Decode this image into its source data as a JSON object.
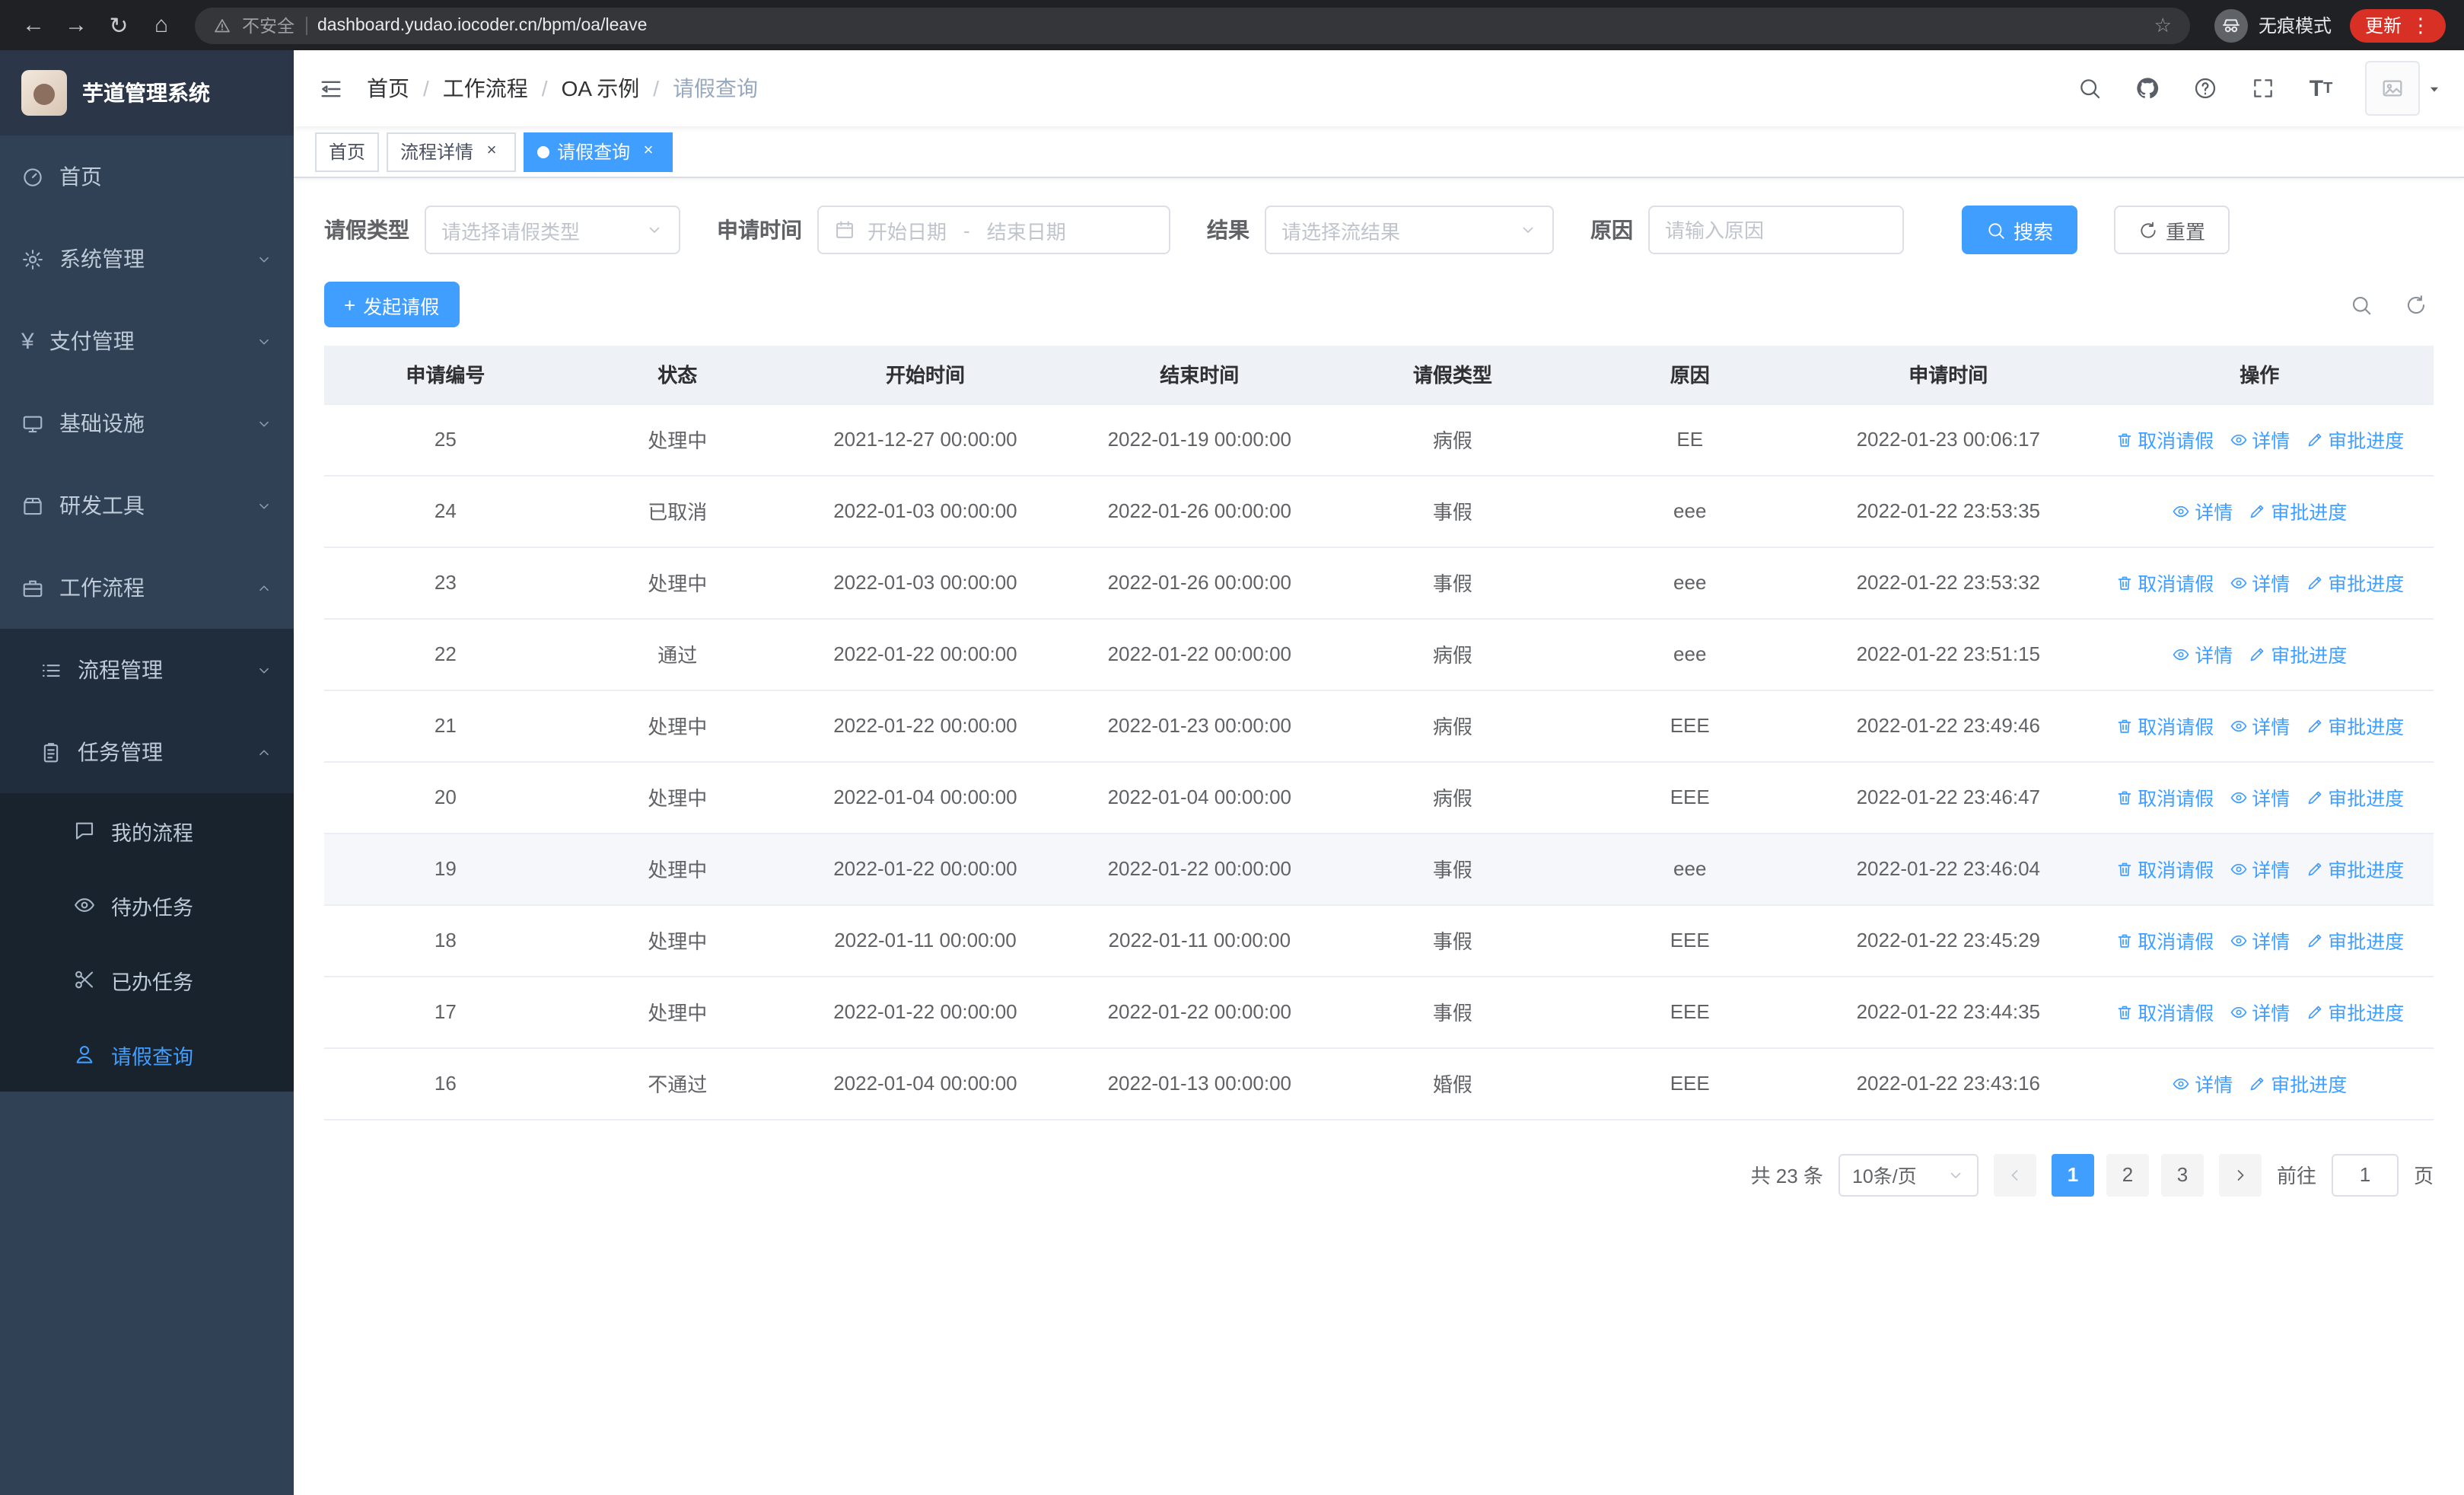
{
  "browser": {
    "security_warning": "不安全",
    "url": "dashboard.yudao.iocoder.cn/bpm/oa/leave",
    "incognito_label": "无痕模式",
    "update_label": "更新"
  },
  "glyphs": {
    "back": "←",
    "forward": "→",
    "reload": "↻",
    "home": "⌂",
    "star": "☆",
    "kebab": "⋮",
    "plus": "+",
    "close": "×",
    "breadcrumb_sep": "/",
    "font_large": "T",
    "font_small": "T"
  },
  "sidebar": {
    "logo_title": "芋道管理系统",
    "items": [
      {
        "key": "home",
        "label": "首页",
        "icon": "dashboard",
        "level": 1
      },
      {
        "key": "system-management",
        "label": "系统管理",
        "icon": "gear",
        "level": 1,
        "arrow": "down"
      },
      {
        "key": "payment-management",
        "label": "支付管理",
        "icon": "yen",
        "level": 1,
        "arrow": "down"
      },
      {
        "key": "infrastructure",
        "label": "基础设施",
        "icon": "monitor",
        "level": 1,
        "arrow": "down"
      },
      {
        "key": "dev-tools",
        "label": "研发工具",
        "icon": "box",
        "level": 1,
        "arrow": "down"
      },
      {
        "key": "workflow",
        "label": "工作流程",
        "icon": "briefcase",
        "level": 1,
        "arrow": "up"
      },
      {
        "key": "process-management",
        "label": "流程管理",
        "icon": "list",
        "level": 2,
        "arrow": "down"
      },
      {
        "key": "task-management",
        "label": "任务管理",
        "icon": "clipboard",
        "level": 2,
        "arrow": "up"
      },
      {
        "key": "my-process",
        "label": "我的流程",
        "icon": "message",
        "level": 3
      },
      {
        "key": "todo-tasks",
        "label": "待办任务",
        "icon": "eye",
        "level": 3
      },
      {
        "key": "done-tasks",
        "label": "已办任务",
        "icon": "scissors",
        "level": 3
      },
      {
        "key": "leave-query",
        "label": "请假查询",
        "icon": "user",
        "level": 3,
        "active": true
      }
    ]
  },
  "navbar": {
    "breadcrumb": [
      "首页",
      "工作流程",
      "OA 示例",
      "请假查询"
    ]
  },
  "tabs": [
    {
      "key": "home",
      "label": "首页",
      "closable": false,
      "active": false
    },
    {
      "key": "process-detail",
      "label": "流程详情",
      "closable": true,
      "active": false
    },
    {
      "key": "leave-query",
      "label": "请假查询",
      "closable": true,
      "active": true
    }
  ],
  "filters": {
    "type_label": "请假类型",
    "type_placeholder": "请选择请假类型",
    "time_label": "申请时间",
    "start_placeholder": "开始日期",
    "range_separator": "-",
    "end_placeholder": "结束日期",
    "result_label": "结果",
    "result_placeholder": "请选择流结果",
    "reason_label": "原因",
    "reason_placeholder": "请输入原因",
    "search_label": "搜索",
    "reset_label": "重置"
  },
  "toolbar": {
    "create_label": "发起请假"
  },
  "table": {
    "columns": [
      "申请编号",
      "状态",
      "开始时间",
      "结束时间",
      "请假类型",
      "原因",
      "申请时间",
      "操作"
    ],
    "action_labels": {
      "cancel": "取消请假",
      "detail": "详情",
      "progress": "审批进度"
    },
    "rows": [
      {
        "id": "25",
        "status": "处理中",
        "start": "2021-12-27 00:00:00",
        "end": "2022-01-19 00:00:00",
        "type": "病假",
        "reason": "EE",
        "applied": "2022-01-23 00:06:17",
        "actions": [
          "cancel",
          "detail",
          "progress"
        ],
        "highlight": false
      },
      {
        "id": "24",
        "status": "已取消",
        "start": "2022-01-03 00:00:00",
        "end": "2022-01-26 00:00:00",
        "type": "事假",
        "reason": "eee",
        "applied": "2022-01-22 23:53:35",
        "actions": [
          "detail",
          "progress"
        ],
        "highlight": false
      },
      {
        "id": "23",
        "status": "处理中",
        "start": "2022-01-03 00:00:00",
        "end": "2022-01-26 00:00:00",
        "type": "事假",
        "reason": "eee",
        "applied": "2022-01-22 23:53:32",
        "actions": [
          "cancel",
          "detail",
          "progress"
        ],
        "highlight": false
      },
      {
        "id": "22",
        "status": "通过",
        "start": "2022-01-22 00:00:00",
        "end": "2022-01-22 00:00:00",
        "type": "病假",
        "reason": "eee",
        "applied": "2022-01-22 23:51:15",
        "actions": [
          "detail",
          "progress"
        ],
        "highlight": false
      },
      {
        "id": "21",
        "status": "处理中",
        "start": "2022-01-22 00:00:00",
        "end": "2022-01-23 00:00:00",
        "type": "病假",
        "reason": "EEE",
        "applied": "2022-01-22 23:49:46",
        "actions": [
          "cancel",
          "detail",
          "progress"
        ],
        "highlight": false
      },
      {
        "id": "20",
        "status": "处理中",
        "start": "2022-01-04 00:00:00",
        "end": "2022-01-04 00:00:00",
        "type": "病假",
        "reason": "EEE",
        "applied": "2022-01-22 23:46:47",
        "actions": [
          "cancel",
          "detail",
          "progress"
        ],
        "highlight": false
      },
      {
        "id": "19",
        "status": "处理中",
        "start": "2022-01-22 00:00:00",
        "end": "2022-01-22 00:00:00",
        "type": "事假",
        "reason": "eee",
        "applied": "2022-01-22 23:46:04",
        "actions": [
          "cancel",
          "detail",
          "progress"
        ],
        "highlight": true
      },
      {
        "id": "18",
        "status": "处理中",
        "start": "2022-01-11 00:00:00",
        "end": "2022-01-11 00:00:00",
        "type": "事假",
        "reason": "EEE",
        "applied": "2022-01-22 23:45:29",
        "actions": [
          "cancel",
          "detail",
          "progress"
        ],
        "highlight": false
      },
      {
        "id": "17",
        "status": "处理中",
        "start": "2022-01-22 00:00:00",
        "end": "2022-01-22 00:00:00",
        "type": "事假",
        "reason": "EEE",
        "applied": "2022-01-22 23:44:35",
        "actions": [
          "cancel",
          "detail",
          "progress"
        ],
        "highlight": false
      },
      {
        "id": "16",
        "status": "不通过",
        "start": "2022-01-04 00:00:00",
        "end": "2022-01-13 00:00:00",
        "type": "婚假",
        "reason": "EEE",
        "applied": "2022-01-22 23:43:16",
        "actions": [
          "detail",
          "progress"
        ],
        "highlight": false
      }
    ]
  },
  "pagination": {
    "total_label": "共 23 条",
    "page_size": "10条/页",
    "pages": [
      "1",
      "2",
      "3"
    ],
    "active_page": "1",
    "goto_label": "前往",
    "goto_value": "1",
    "unit_label": "页"
  },
  "colors": {
    "primary": "#409eff",
    "link": "#409eff",
    "sidebar_bg": "#304156",
    "sidebar_submenu_bg": "#1f2d3d",
    "sidebar_active_text": "#409eff",
    "table_header_bg": "#eef1f6",
    "tab_active_bg": "#409eff",
    "chrome_bar_bg": "#202124",
    "update_button_bg": "#d93025"
  }
}
